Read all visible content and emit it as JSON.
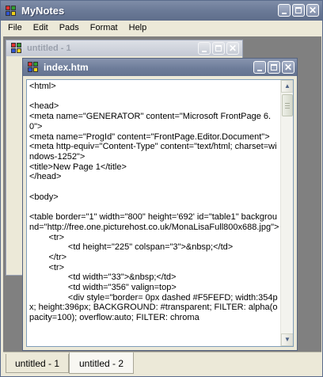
{
  "window": {
    "title": "MyNotes"
  },
  "menu": {
    "items": [
      "File",
      "Edit",
      "Pads",
      "Format",
      "Help"
    ]
  },
  "children": {
    "background": {
      "title": "untitled - 1"
    },
    "active": {
      "title": "index.htm",
      "content": "<html>\n\n<head>\n<meta name=\"GENERATOR\" content=\"Microsoft FrontPage 6.0\">\n<meta name=\"ProgId\" content=\"FrontPage.Editor.Document\">\n<meta http-equiv=\"Content-Type\" content=\"text/html; charset=windows-1252\">\n<title>New Page 1</title>\n</head>\n\n<body>\n\n<table border=\"1\" width=\"800\" height='692' id=\"table1\" background=\"http://free.one.picturehost.co.uk/MonaLisaFull800x688.jpg\">\n\t<tr>\n\t\t<td height=\"225\" colspan=\"3\">&nbsp;</td>\n\t</tr>\n\t<tr>\n\t\t<td width=\"33\">&nbsp;</td>\n\t\t<td width=\"356\" valign=top>\n\t\t<div style=\"border= 0px dashed #F5FEFD; width:354px; height:396px; BACKGROUND: #transparent; FILTER: alpha(opacity=100); overflow:auto; FILTER: chroma"
    }
  },
  "tabs": [
    "untitled - 1",
    "untitled - 2"
  ],
  "colors": {
    "titlebar": "#6b7a97",
    "mdi_background": "#808080",
    "window_face": "#ece9d8"
  }
}
